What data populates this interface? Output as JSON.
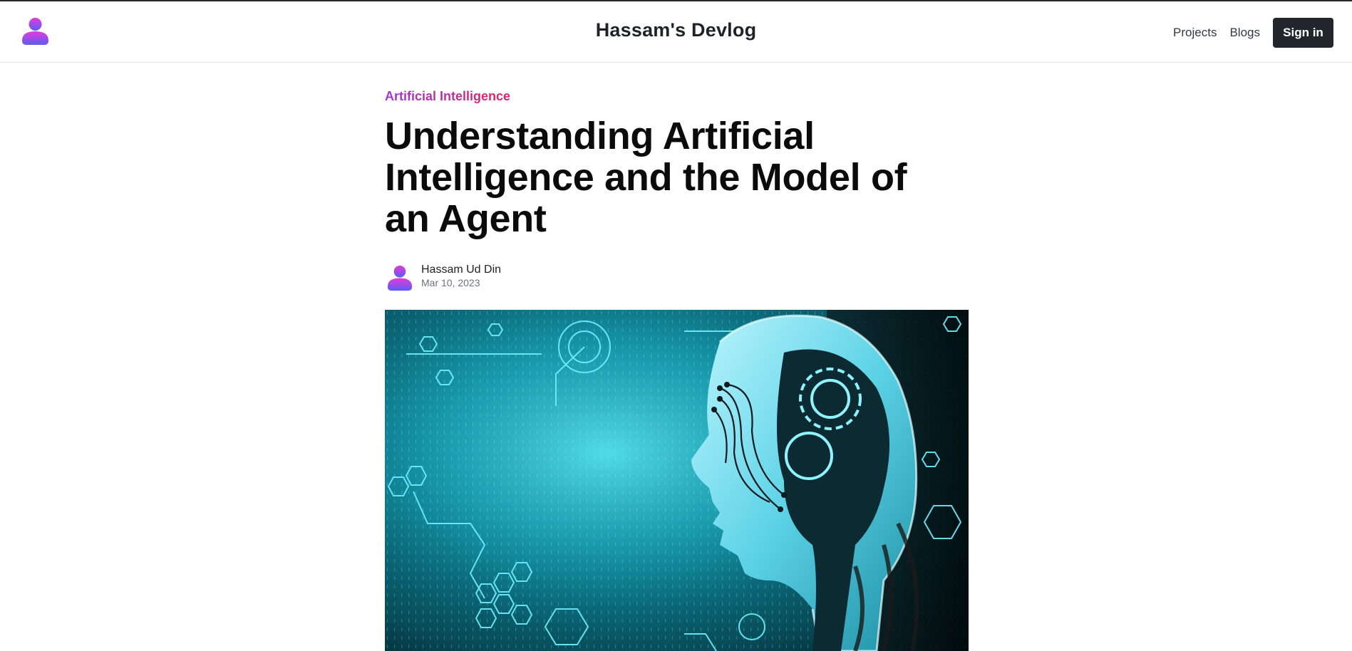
{
  "header": {
    "site_title": "Hassam's Devlog",
    "nav": [
      {
        "label": "Projects"
      },
      {
        "label": "Blogs"
      }
    ],
    "signin_label": "Sign in"
  },
  "article": {
    "category": "Artificial Intelligence",
    "title": "Understanding Artificial Intelligence and the Model of an Agent",
    "author": {
      "name": "Hassam Ud Din",
      "date": "Mar 10, 2023"
    }
  },
  "colors": {
    "accent_gradient_start": "#9f37d6",
    "accent_gradient_end": "#e0245e",
    "button_bg": "#22262b",
    "avatar_gradient_top": "#e639d9",
    "avatar_gradient_bottom": "#5b5cf6"
  },
  "icons": {
    "logo": "user-avatar-icon",
    "author_avatar": "user-avatar-icon"
  }
}
